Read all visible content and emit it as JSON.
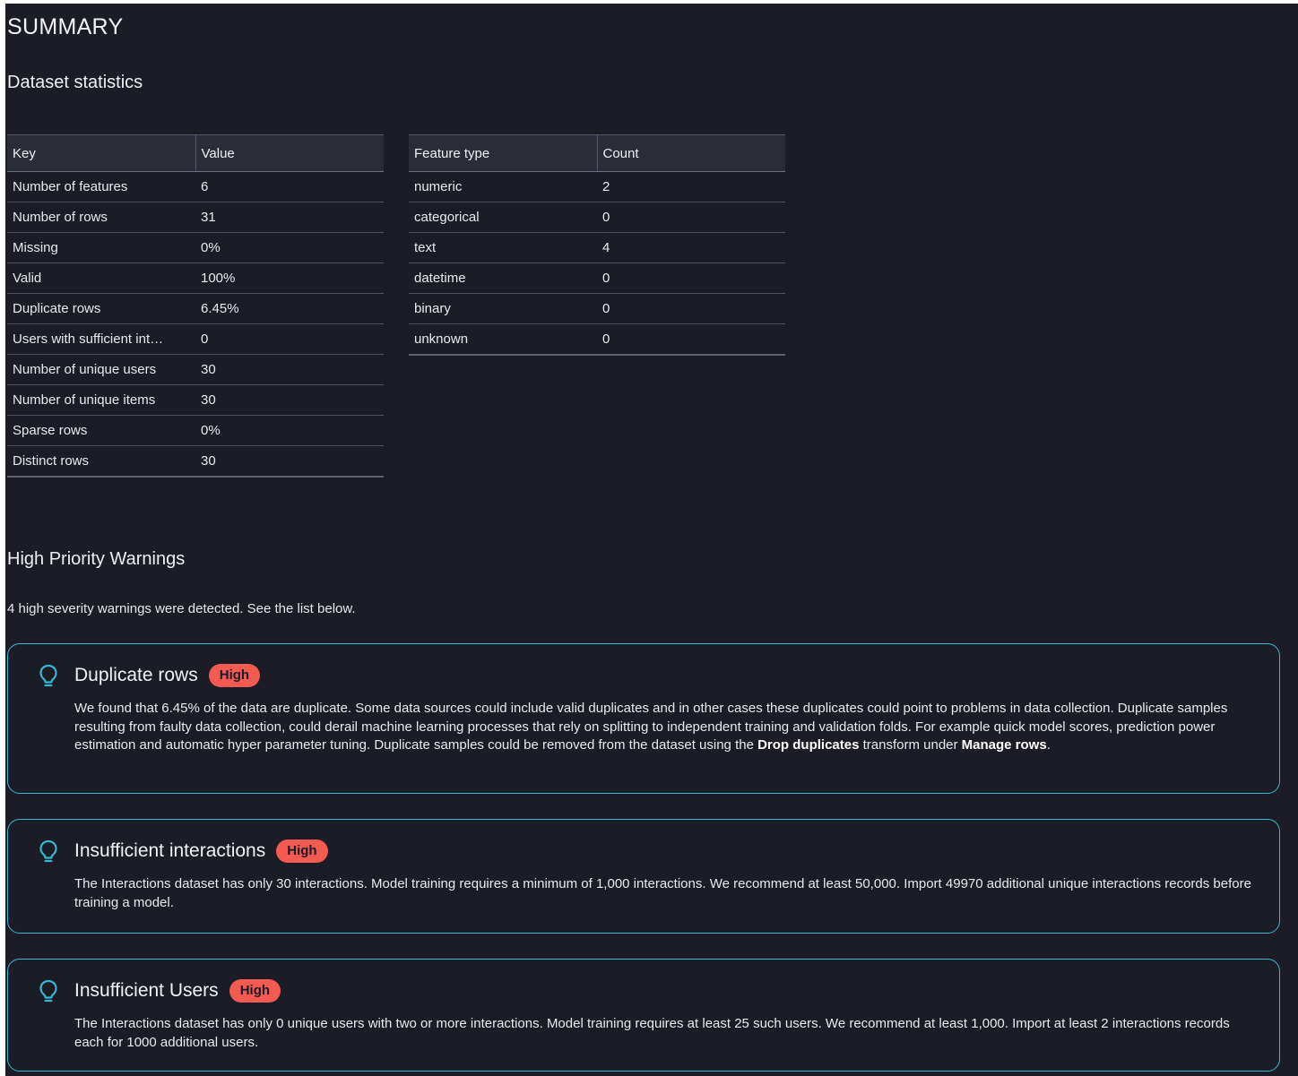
{
  "header": {
    "title": "SUMMARY"
  },
  "dataset_statistics": {
    "title": "Dataset statistics",
    "key_table": {
      "columns": [
        "Key",
        "Value"
      ],
      "rows": [
        {
          "key": "Number of features",
          "value": "6"
        },
        {
          "key": "Number of rows",
          "value": "31"
        },
        {
          "key": "Missing",
          "value": "0%"
        },
        {
          "key": "Valid",
          "value": "100%"
        },
        {
          "key": "Duplicate rows",
          "value": "6.45%"
        },
        {
          "key": "Users with sufficient int…",
          "value": "0"
        },
        {
          "key": "Number of unique users",
          "value": "30"
        },
        {
          "key": "Number of unique items",
          "value": "30"
        },
        {
          "key": "Sparse rows",
          "value": "0%"
        },
        {
          "key": "Distinct rows",
          "value": "30"
        }
      ]
    },
    "type_table": {
      "columns": [
        "Feature type",
        "Count"
      ],
      "rows": [
        {
          "type": "numeric",
          "count": "2"
        },
        {
          "type": "categorical",
          "count": "0"
        },
        {
          "type": "text",
          "count": "4"
        },
        {
          "type": "datetime",
          "count": "0"
        },
        {
          "type": "binary",
          "count": "0"
        },
        {
          "type": "unknown",
          "count": "0"
        }
      ]
    }
  },
  "warnings": {
    "title": "High Priority Warnings",
    "summary": "4 high severity warnings were detected. See the list below.",
    "items": [
      {
        "icon": "lightbulb-icon",
        "title": "Duplicate rows",
        "severity": "High",
        "body_part1": "We found that 6.45% of the data are duplicate. Some data sources could include valid duplicates and in other cases these duplicates could point to problems in data collection. Duplicate samples resulting from faulty data collection, could derail machine learning processes that rely on splitting to independent training and validation folds. For example quick model scores, prediction power estimation and automatic hyper parameter tuning. Duplicate samples could be removed from the dataset using the ",
        "body_bold1": "Drop duplicates",
        "body_part2": " transform under ",
        "body_bold2": "Manage rows",
        "body_part3": "."
      },
      {
        "icon": "lightbulb-icon",
        "title": "Insufficient interactions",
        "severity": "High",
        "body": "The Interactions dataset has only 30 interactions. Model training requires a minimum of 1,000 interactions. We recommend at least 50,000. Import 49970 additional unique interactions records before training a model."
      },
      {
        "icon": "lightbulb-icon",
        "title": "Insufficient Users",
        "severity": "High",
        "body": "The Interactions dataset has only 0 unique users with two or more interactions. Model training requires at least 25 such users. We recommend at least 1,000. Import at least 2 interactions records each for 1000 additional users."
      }
    ]
  },
  "colors": {
    "background": "#1b1c26",
    "card_border": "#39b6cf",
    "badge_high": "#f25a52",
    "icon_accent": "#39b6cf"
  }
}
